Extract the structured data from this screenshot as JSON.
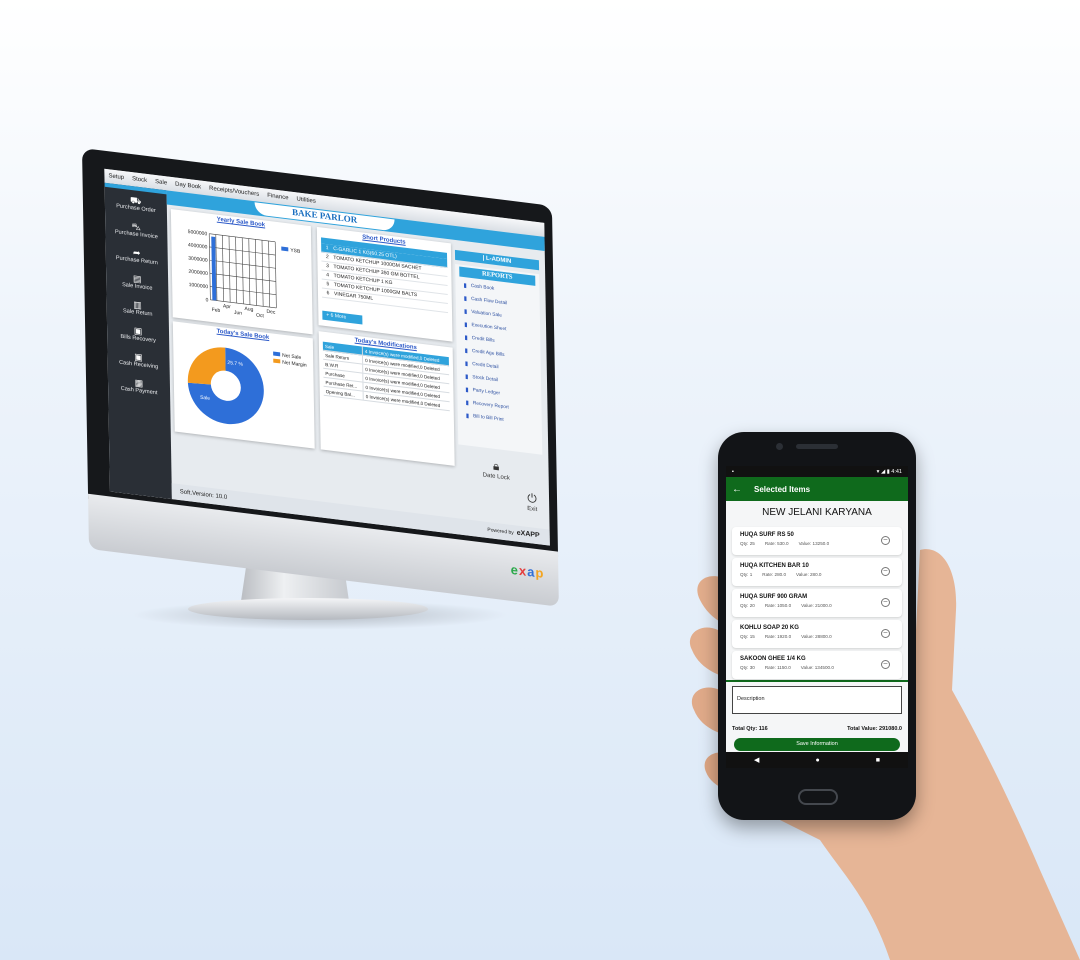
{
  "desktop": {
    "menu": [
      "Setup",
      "Stock",
      "Sale",
      "Day Book",
      "Receipts/Vouchers",
      "Finance",
      "Utilities"
    ],
    "app_title": "BAKE PARLOR",
    "sidebar": [
      {
        "label": "Purchase Order",
        "icon": "basket-icon"
      },
      {
        "label": "Purchase Invoice",
        "icon": "cart-icon"
      },
      {
        "label": "Purchase Return",
        "icon": "return-arrow-icon"
      },
      {
        "label": "Sale Invoice",
        "icon": "document-icon"
      },
      {
        "label": "Sale Return",
        "icon": "document-return-icon"
      },
      {
        "label": "Bills Recovery",
        "icon": "money-icon"
      },
      {
        "label": "Cash Receiving",
        "icon": "cash-in-icon"
      },
      {
        "label": "Cash Payment",
        "icon": "cash-out-icon"
      }
    ],
    "yearly_chart": {
      "title": "Yearly Sale Book",
      "legend": "YSB"
    },
    "today_chart": {
      "title": "Today's Sale Book",
      "legend": [
        "Net Sale",
        "Net Margin"
      ],
      "slice_labels": [
        "Sale",
        "25.7 %"
      ]
    },
    "short_products": {
      "title": "Short Products",
      "rows": [
        {
          "n": "1",
          "name": "C-GARLIC 1 KG(60.25 OTL)"
        },
        {
          "n": "2",
          "name": "TOMATO KETCHUP 1000GM SACHET"
        },
        {
          "n": "3",
          "name": "TOMATO KETCHUP 350 GM BOTTEL"
        },
        {
          "n": "4",
          "name": "TOMATO KETCHUP 1 KG"
        },
        {
          "n": "5",
          "name": "TOMATO KETCHUP 1000GM BALTS"
        },
        {
          "n": "6",
          "name": "VINEGAR 750ML"
        }
      ],
      "more": "+ 6 More"
    },
    "modifications": {
      "title": "Today's Modifications",
      "rows": [
        {
          "k": "Sale",
          "v": "4 Invoice(s) were modified,0 Deleted"
        },
        {
          "k": "Sale Return",
          "v": "0 Invoice(s) were modified,0 Deleted"
        },
        {
          "k": "B.W.R",
          "v": "0 Invoice(s) were modified,0 Deleted"
        },
        {
          "k": "Purchase",
          "v": "0 Invoice(s) were modified,0 Deleted"
        },
        {
          "k": "Purchase Ret...",
          "v": "0 Invoice(s) were modified,0 Deleted"
        },
        {
          "k": "Opening Bal...",
          "v": "0 Invoice(s) were modified,0 Deleted"
        }
      ]
    },
    "admin": "| L-ADMIN",
    "reports": {
      "title": "REPORTS",
      "items": [
        "Cash Book",
        "Cash Flow Detail",
        "Valuation Sale",
        "Execution Sheet",
        "Credit Bills",
        "Credit Age Bills",
        "Credit Detail",
        "Stock Detail",
        "Party Ledger",
        "Recovery Report",
        "Bill to Bill Print"
      ]
    },
    "date_lock": "Date Lock",
    "exit": "Exit",
    "version": "Soft.Version: 10.0",
    "powered_by": "Powered by",
    "powered_brand": "eXAPP",
    "chin_logo": [
      "e",
      "x",
      "a",
      "p"
    ]
  },
  "chart_data": [
    {
      "type": "bar",
      "title": "Yearly Sale Book",
      "categories": [
        "Feb",
        "Apr",
        "Jun",
        "Aug",
        "Oct",
        "Dec"
      ],
      "series": [
        {
          "name": "YSB",
          "values": [
            4800000,
            0,
            0,
            0,
            0,
            0
          ]
        }
      ],
      "ylim": [
        0,
        5000000
      ],
      "yticks": [
        0,
        1000000,
        2000000,
        3000000,
        4000000,
        5000000
      ],
      "grid": true,
      "legend": "right"
    },
    {
      "type": "pie",
      "title": "Today's Sale Book",
      "labels": [
        "Net Sale",
        "Net Margin"
      ],
      "values": [
        74.3,
        25.7
      ],
      "colors": [
        "#2e6fd8",
        "#f39a1e"
      ],
      "donut": true
    }
  ],
  "mobile": {
    "status_time": "4:41",
    "title": "Selected Items",
    "shop": "NEW JELANI KARYANA",
    "items": [
      {
        "name": "HUQA SURF RS 50",
        "qty": "Qty: 25",
        "rate": "Rate: 530.0",
        "value": "Value: 13250.0"
      },
      {
        "name": "HUQA KITCHEN BAR 10",
        "qty": "Qty: 1",
        "rate": "Rate: 280.0",
        "value": "Value: 280.0"
      },
      {
        "name": "HUQA SURF 900 GRAM",
        "qty": "Qty: 20",
        "rate": "Rate: 1050.0",
        "value": "Value: 21000.0"
      },
      {
        "name": "KOHLU SOAP 20 KG",
        "qty": "Qty: 15",
        "rate": "Rate: 1920.0",
        "value": "Value: 28800.0"
      },
      {
        "name": "SAKOON GHEE 1/4 KG",
        "qty": "Qty: 30",
        "rate": "Rate: 1150.0",
        "value": "Value: 134500.0"
      }
    ],
    "description_placeholder": "Description",
    "total_qty": "Total Qty: 116",
    "total_value": "Total Value: 291080.0",
    "save": "Save Information"
  },
  "colors": {
    "accent": "#2fa3dc",
    "mobile_green": "#0f6a1c",
    "sidebar": "#2a2f36"
  }
}
